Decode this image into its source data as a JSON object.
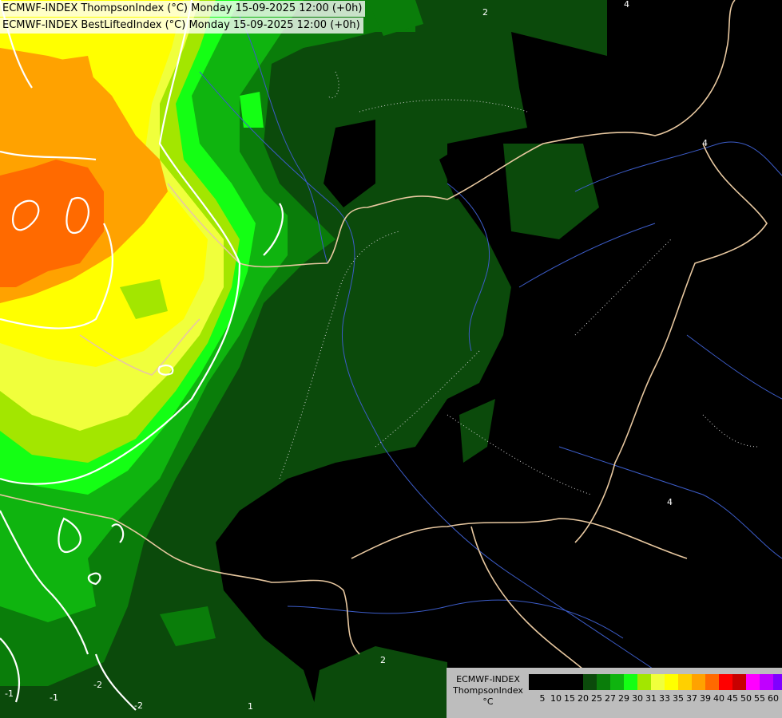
{
  "titles": [
    "ECMWF-INDEX ThompsonIndex (°C) Monday 15-09-2025 12:00 (+0h)",
    "ECMWF-INDEX BestLiftedIndex (°C) Monday 15-09-2025 12:00 (+0h)"
  ],
  "legend": {
    "label_lines": [
      "ECMWF-INDEX",
      "ThompsonIndex",
      "°C"
    ],
    "colors": [
      "#000000",
      "#000000",
      "#000000",
      "#000000",
      "#0b4a0b",
      "#0a7d0a",
      "#0fb40f",
      "#14ff14",
      "#a3e600",
      "#f0ff3c",
      "#ffff00",
      "#ffd000",
      "#ffa200",
      "#ff6a00",
      "#ff0000",
      "#c80000",
      "#ff00ff",
      "#c000ff",
      "#8000ff",
      "#3c00ff",
      "#0000ff"
    ],
    "ticks": [
      "5",
      "10",
      "15",
      "20",
      "25",
      "27",
      "29",
      "30",
      "31",
      "33",
      "35",
      "37",
      "39",
      "40",
      "45",
      "50",
      "55",
      "60"
    ]
  },
  "contour_labels": [
    "2",
    "4",
    "4",
    "4",
    "4",
    "-2",
    "-2",
    "-1",
    "1",
    "2",
    "-1"
  ]
}
